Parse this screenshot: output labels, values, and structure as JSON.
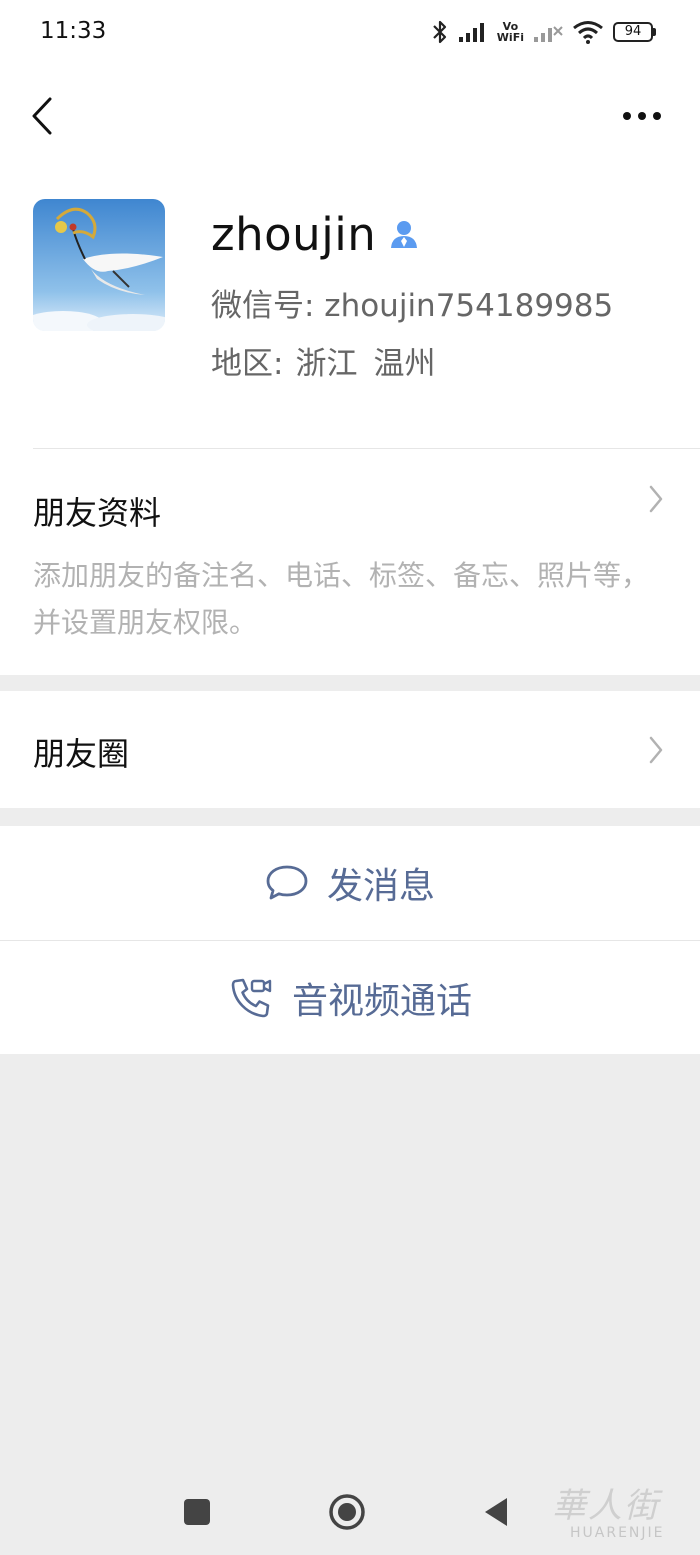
{
  "status_bar": {
    "time": "11:33",
    "volte_top": "Vo",
    "volte_bottom": "WiFi",
    "battery": "94",
    "icons": [
      "bluetooth-icon",
      "signal-icon",
      "volte-wifi-icon",
      "signal-off-icon",
      "wifi-icon",
      "battery-icon"
    ]
  },
  "header": {
    "back_icon": "chevron-left-icon",
    "more_icon": "ellipsis-icon"
  },
  "profile": {
    "name": "zhoujin",
    "wechat_id": "微信号: zhoujin754189985",
    "region_label": "地区:",
    "region_province": "浙江",
    "region_city": "温州",
    "gender_icon": "male-person-icon"
  },
  "friend_info": {
    "title": "朋友资料",
    "description": "添加朋友的备注名、电话、标签、备忘、照片等，并设置朋友权限。"
  },
  "moments": {
    "title": "朋友圈"
  },
  "actions": {
    "message": "发消息",
    "call": "音视频通话"
  },
  "navbar": {
    "icons": [
      "recents-square-icon",
      "home-circle-icon",
      "back-triangle-icon"
    ]
  },
  "watermark": {
    "glyphs": "華人街",
    "text": "HUARENJIE"
  },
  "colors": {
    "link_blue": "#576b95",
    "gender_blue": "#5b9bf0",
    "page_gray": "#ededed",
    "description_gray": "#b2b2b2"
  }
}
